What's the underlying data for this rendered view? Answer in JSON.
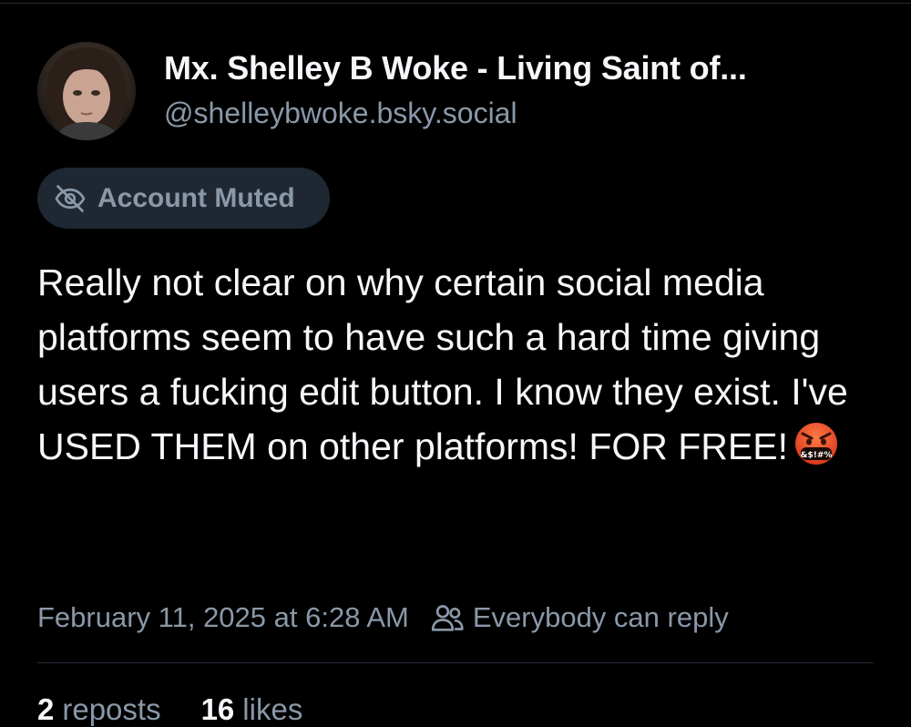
{
  "author": {
    "display_name": "Mx. Shelley B Woke - Living Saint of...",
    "handle": "@shelleybwoke.bsky.social",
    "avatar": "avatar-photo"
  },
  "muted_badge": {
    "label": "Account Muted",
    "icon": "eye-off-icon"
  },
  "post": {
    "text": "Really not clear on why certain social media platforms seem to have such a hard time giving users a fucking edit button. I know they exist. I've USED THEM on other platforms! FOR FREE!",
    "emoji": "face-with-symbols-on-mouth",
    "emoji_symbols": "&$!#%"
  },
  "meta": {
    "timestamp": "February 11, 2025 at 6:28 AM",
    "reply_icon": "people-icon",
    "reply_setting": "Everybody can reply"
  },
  "stats": {
    "reposts_count": "2",
    "reposts_label": "reposts",
    "likes_count": "16",
    "likes_label": "likes"
  },
  "colors": {
    "background": "#000000",
    "text_primary": "#f5f7fa",
    "text_secondary": "#8a98a8",
    "pill_background": "#1e2732"
  }
}
